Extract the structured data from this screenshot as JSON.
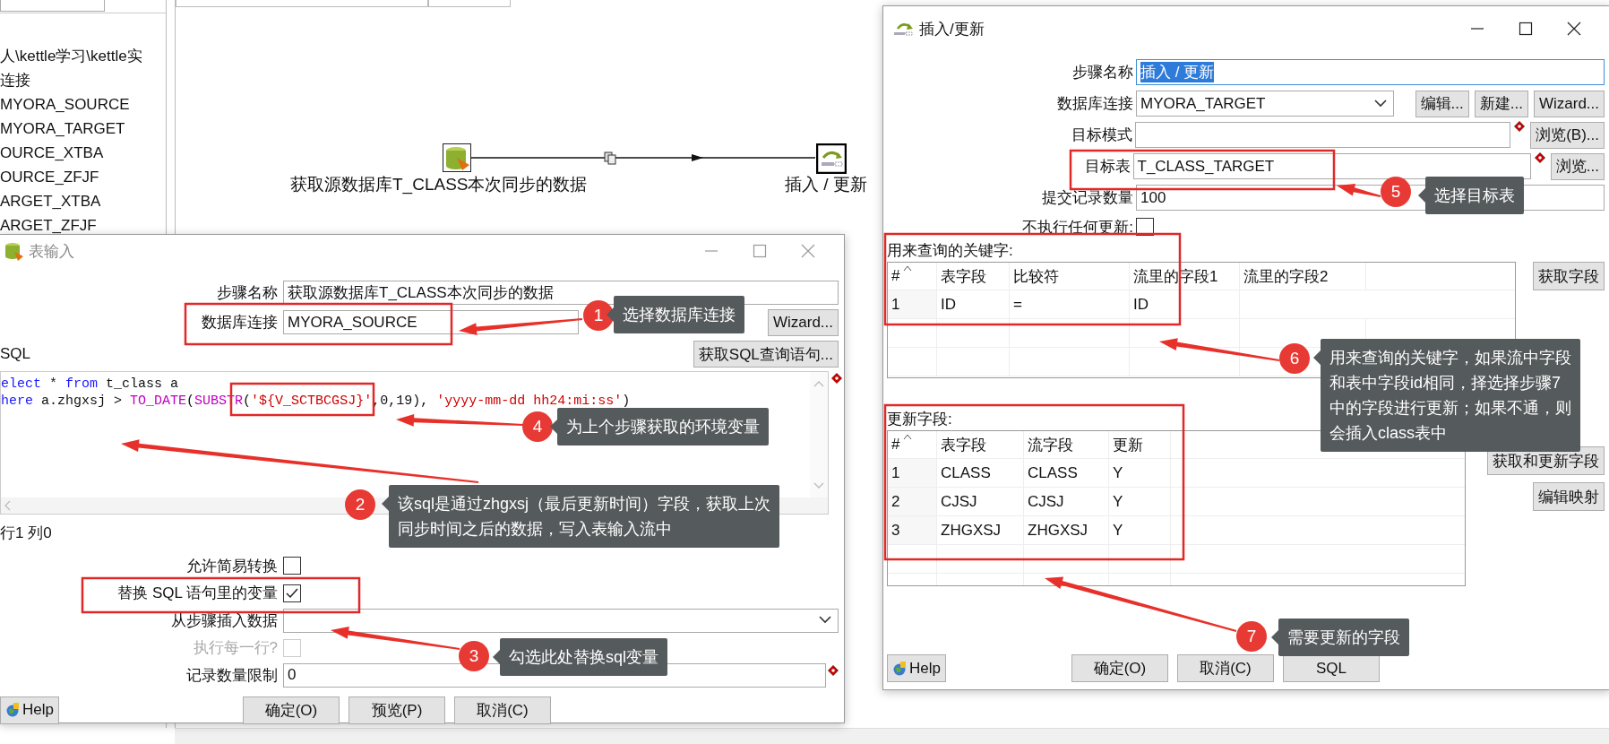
{
  "sidebar": {
    "items": [
      {
        "label": "人\\kettle学习\\kettle实"
      },
      {
        "label": "连接"
      },
      {
        "label": "MYORA_SOURCE"
      },
      {
        "label": "MYORA_TARGET"
      },
      {
        "label": "OURCE_XTBA"
      },
      {
        "label": "OURCE_ZFJF"
      },
      {
        "label": "ARGET_XTBA"
      },
      {
        "label": "ARGET_ZFJF"
      }
    ]
  },
  "canvas": {
    "steps": [
      {
        "label": "获取源数据库T_CLASS本次同步的数据"
      },
      {
        "label": "插入 / 更新"
      }
    ]
  },
  "table_input_dialog": {
    "title": "表输入",
    "step_name_label": "步骤名称",
    "step_name": "获取源数据库T_CLASS本次同步的数据",
    "connection_label": "数据库连接",
    "connection": "MYORA_SOURCE",
    "wizard_button": "Wizard...",
    "sql_label": "SQL",
    "get_sql_button": "获取SQL查询语句...",
    "sql_lines": [
      {
        "tokens": [
          {
            "kind": "keyword",
            "text": "elect"
          },
          {
            "kind": "plain",
            "text": " * "
          },
          {
            "kind": "keyword",
            "text": "from"
          },
          {
            "kind": "plain",
            "text": " t_class a"
          }
        ]
      },
      {
        "tokens": [
          {
            "kind": "keyword",
            "text": "here"
          },
          {
            "kind": "plain",
            "text": " a.zhgxsj > "
          },
          {
            "kind": "function",
            "text": "TO_DATE"
          },
          {
            "kind": "plain",
            "text": "("
          },
          {
            "kind": "function",
            "text": "SUBSTR"
          },
          {
            "kind": "plain",
            "text": "("
          },
          {
            "kind": "string",
            "text": "'${V_SCTBCGSJ}'"
          },
          {
            "kind": "plain",
            "text": ",0,19), "
          },
          {
            "kind": "string",
            "text": "'yyyy-mm-dd hh24:mi:ss'"
          },
          {
            "kind": "plain",
            "text": ")"
          }
        ]
      }
    ],
    "cursor_position": "行1 列0",
    "options": [
      {
        "label": "允许简易转换",
        "checked": false,
        "disabled": false
      },
      {
        "label": "替换 SQL 语句里的变量",
        "checked": true,
        "disabled": false
      }
    ],
    "insert_from_step_label": "从步骤插入数据",
    "execute_each_row": {
      "label": "执行每一行?",
      "checked": false,
      "disabled": true
    },
    "limit_label": "记录数量限制",
    "limit": "0",
    "help_button": "Help",
    "buttons": [
      "确定(O)",
      "预览(P)",
      "取消(C)"
    ]
  },
  "insert_update_dialog": {
    "title": "插入/更新",
    "step_name_label": "步骤名称",
    "step_name": "插入 / 更新",
    "connection_label": "数据库连接",
    "connection": "MYORA_TARGET",
    "connection_buttons": [
      "编辑...",
      "新建...",
      "Wizard..."
    ],
    "schema_label": "目标模式",
    "schema_browse_button": "浏览(B)...",
    "table_label": "目标表",
    "table": "T_CLASS_TARGET",
    "table_browse_button": "浏览...",
    "commit_size_label": "提交记录数量",
    "commit_size": "100",
    "no_update": {
      "label": "不执行任何更新:",
      "checked": false
    },
    "key_section": {
      "label": "用来查询的关键字:",
      "columns": [
        "#",
        "表字段",
        "比较符",
        "流里的字段1",
        "流里的字段2"
      ],
      "rows": [
        {
          "cells": [
            "1",
            "ID",
            "=",
            "ID"
          ]
        }
      ],
      "button": "获取字段"
    },
    "update_section": {
      "label": "更新字段:",
      "columns": [
        "#",
        "表字段",
        "流字段",
        "更新"
      ],
      "rows": [
        {
          "cells": [
            "1",
            "CLASS",
            "CLASS",
            "Y"
          ]
        },
        {
          "cells": [
            "2",
            "CJSJ",
            "CJSJ",
            "Y"
          ]
        },
        {
          "cells": [
            "3",
            "ZHGXSJ",
            "ZHGXSJ",
            "Y"
          ]
        }
      ],
      "buttons": [
        "获取和更新字段",
        "编辑映射"
      ]
    },
    "help_button": "Help",
    "buttons": [
      "确定(O)",
      "取消(C)",
      "SQL"
    ]
  },
  "annotations": [
    {
      "number": "1",
      "lines": [
        "选择数据库连接"
      ]
    },
    {
      "number": "2",
      "lines": [
        "该sql是通过zhgxsj（最后更新时间）字段，获取上次",
        "同步时间之后的数据，写入表输入流中"
      ]
    },
    {
      "number": "3",
      "lines": [
        "勾选此处替换sql变量"
      ]
    },
    {
      "number": "4",
      "lines": [
        "为上个步骤获取的环境变量"
      ]
    },
    {
      "number": "5",
      "lines": [
        "选择目标表"
      ]
    },
    {
      "number": "6",
      "lines": [
        "用来查询的关键字，如果流中字段",
        "和表中字段id相同，择选择步骤7",
        "中的字段进行更新；如果不通，则",
        "会插入class表中"
      ]
    },
    {
      "number": "7",
      "lines": [
        "需要更新的字段"
      ]
    }
  ]
}
